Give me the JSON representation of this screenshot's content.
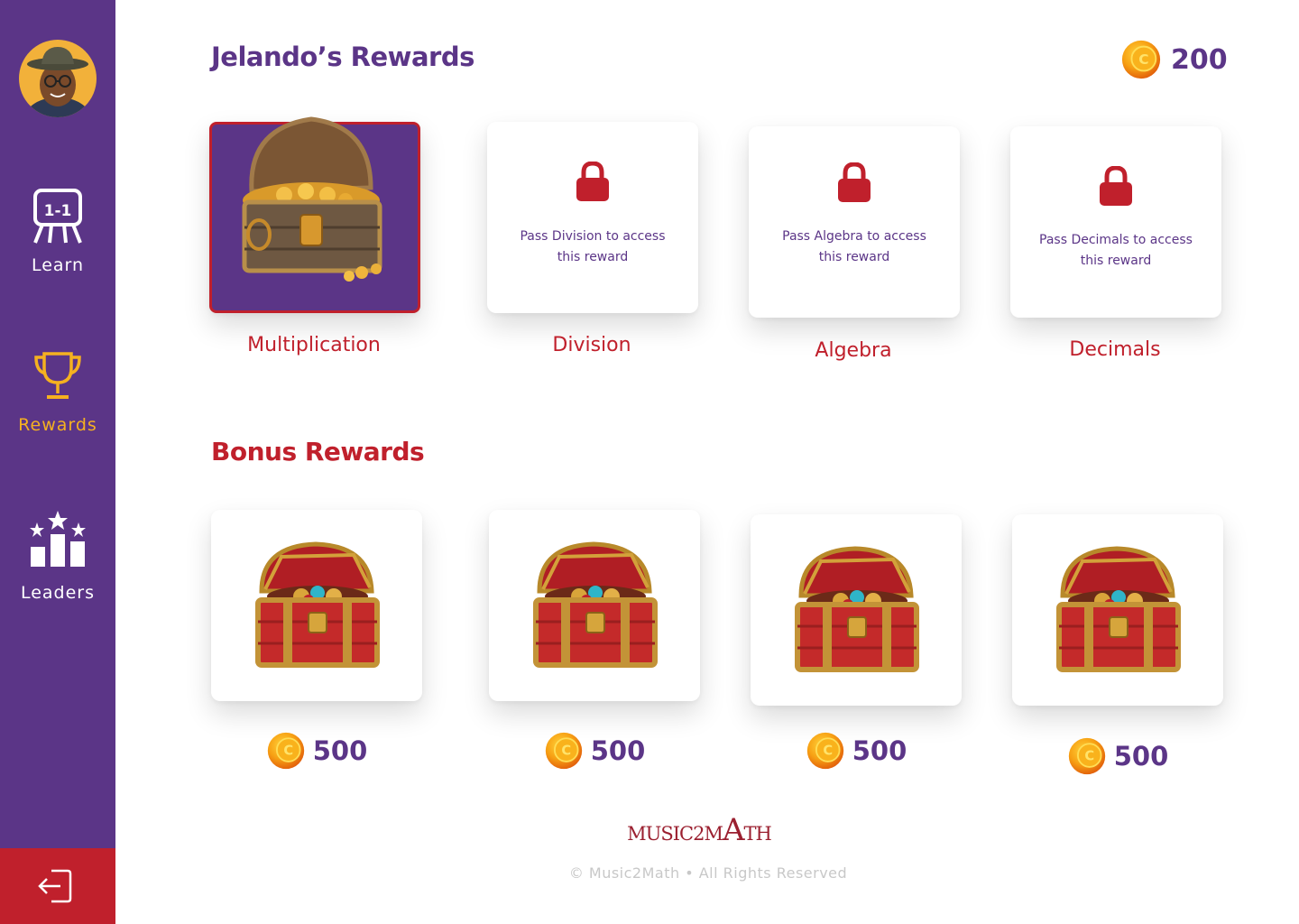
{
  "sidebar": {
    "items": [
      {
        "label": "Learn",
        "icon": "whiteboard-icon"
      },
      {
        "label": "Rewards",
        "icon": "trophy-icon",
        "active": true
      },
      {
        "label": "Leaders",
        "icon": "podium-stars-icon"
      }
    ],
    "logout_icon": "logout-icon"
  },
  "header": {
    "title": "Jelando’s Rewards",
    "coin_balance": "200"
  },
  "rewards": [
    {
      "name": "Multiplication",
      "unlocked": true
    },
    {
      "name": "Division",
      "unlocked": false,
      "lock_text": "Pass Division to access this reward"
    },
    {
      "name": "Algebra",
      "unlocked": false,
      "lock_text": "Pass Algebra to access this reward"
    },
    {
      "name": "Decimals",
      "unlocked": false,
      "lock_text": "Pass Decimals to access this reward"
    }
  ],
  "bonus": {
    "title": "Bonus Rewards",
    "items": [
      {
        "price": "500"
      },
      {
        "price": "500"
      },
      {
        "price": "500"
      },
      {
        "price": "500"
      }
    ]
  },
  "footer": {
    "logo_prefix": "MUSIC2M",
    "logo_a": "A",
    "logo_suffix": "TH",
    "copyright": "© Music2Math • All Rights Reserved"
  },
  "colors": {
    "purple": "#5b3587",
    "red": "#c0202c",
    "gold": "#f5b120"
  }
}
